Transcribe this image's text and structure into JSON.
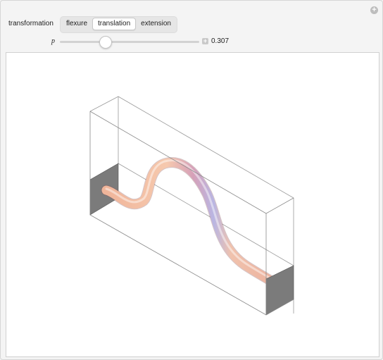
{
  "controls": {
    "transformation_label": "transformation",
    "buttons": [
      "flexure",
      "translation",
      "extension"
    ],
    "active_button": "translation",
    "p_label": "p",
    "p_value": 0.307,
    "p_value_text": "0.307"
  },
  "icons": {
    "corner": "plus-circle-icon",
    "slider_extra": "plus-square-icon"
  },
  "colors": {
    "rod_light": "#f6c4a8",
    "rod_mid": "#e09a8a",
    "rod_blue": "#b6b2e0",
    "end_face": "#7b7b7b",
    "box_line": "#8a8a8a"
  }
}
